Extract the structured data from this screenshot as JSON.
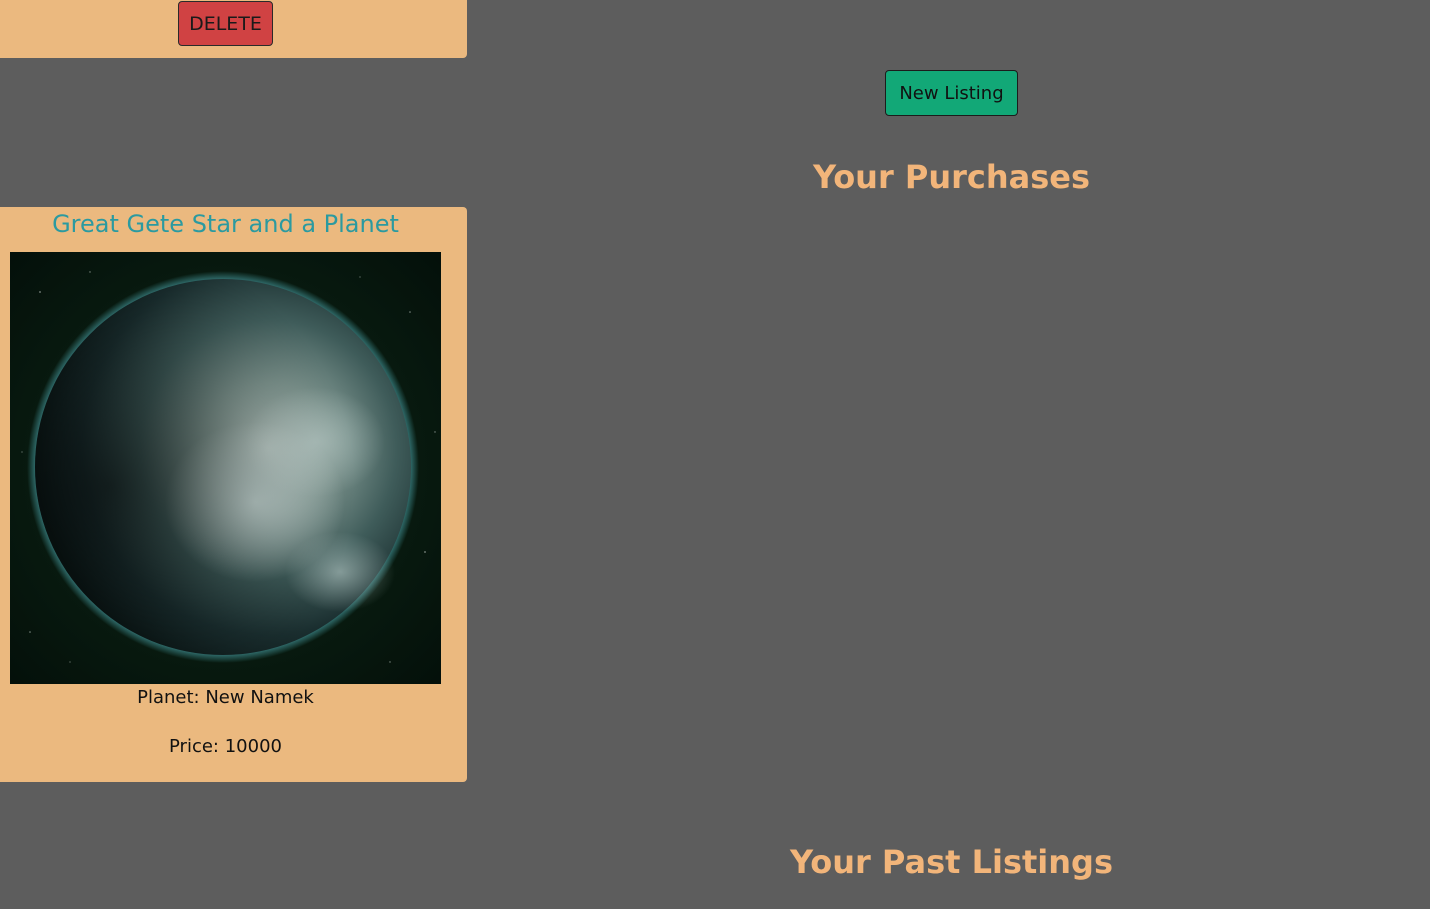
{
  "top_card": {
    "delete_label": "DELETE"
  },
  "listing": {
    "title": "Great Gete Star and a Planet",
    "planet_text": "Planet: New Namek",
    "price_text": "Price: 10000",
    "image_icon": "planet-image"
  },
  "actions": {
    "new_listing_label": "New Listing"
  },
  "sections": {
    "purchases_heading": "Your Purchases",
    "past_listings_heading": "Your Past Listings"
  },
  "colors": {
    "background": "#5d5d5d",
    "card": "#ebb97f",
    "delete_button": "#d04243",
    "new_listing_button": "#12a877",
    "listing_title": "#2b9aa0",
    "section_heading": "#f2b57a"
  }
}
